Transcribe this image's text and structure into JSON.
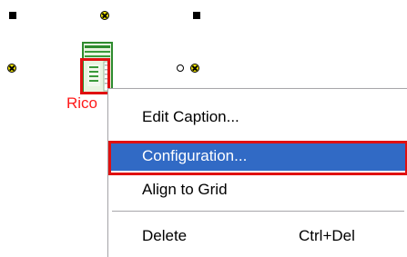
{
  "canvas": {
    "component": {
      "icon": "document-icon",
      "caption": "Rico"
    }
  },
  "context_menu": {
    "items": [
      {
        "label": "Edit Caption...",
        "shortcut": ""
      },
      {
        "label": "Configuration...",
        "shortcut": "",
        "selected": true
      },
      {
        "label": "Align to Grid",
        "shortcut": ""
      },
      {
        "label": "Delete",
        "shortcut": "Ctrl+Del"
      }
    ]
  },
  "colors": {
    "highlight": "#e01010",
    "menu_selection": "#316ac5",
    "caption": "#ff1a1a",
    "icon_border": "#2e8b2e"
  }
}
